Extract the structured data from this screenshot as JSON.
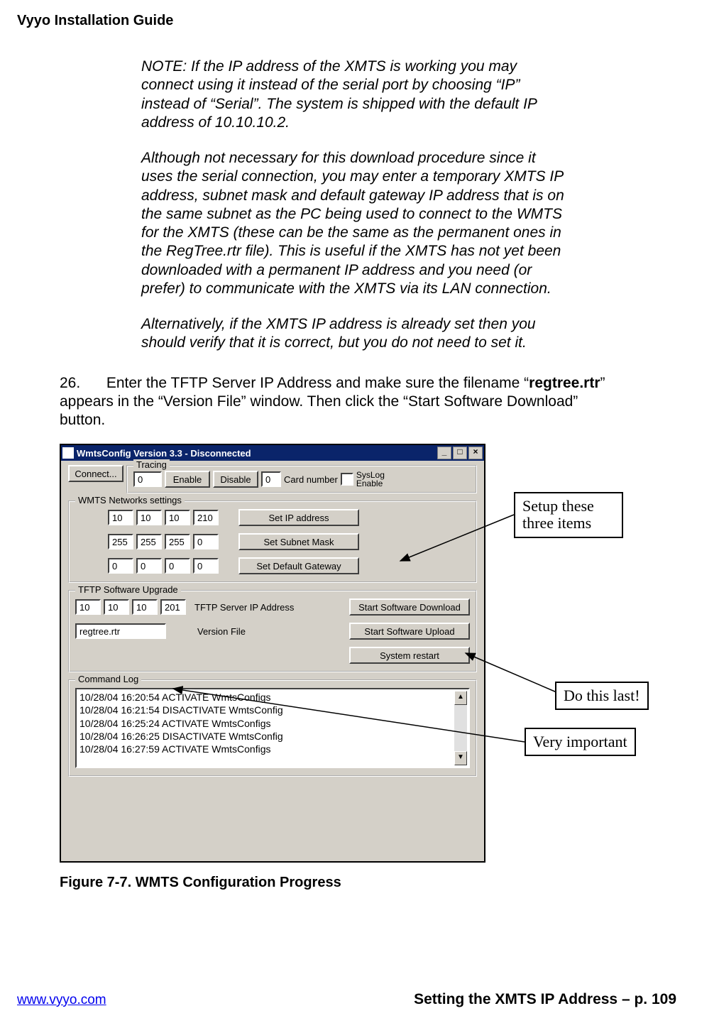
{
  "header": "Vyyo Installation Guide",
  "notes": {
    "p1": "NOTE:  If the IP address of the XMTS is working you may connect using it instead of the serial port by choosing “IP” instead of “Serial”.  The system is shipped with the default IP address of 10.10.10.2.",
    "p2": "Although not necessary for this download procedure since it uses the serial connection, you may enter a temporary XMTS  IP address, subnet mask and default gateway IP address that is on the same subnet as the PC being used to connect to the WMTS for the XMTS (these can be the same as the permanent ones in the RegTree.rtr file).   This is useful if the XMTS has not yet been downloaded with a permanent IP address and you need  (or prefer) to communicate with the XMTS via its LAN connection.",
    "p3": "Alternatively, if the XMTS IP address is already set then you should verify that it is correct, but you do not need to set it."
  },
  "step": {
    "number": "26.",
    "before_bold": "Enter the TFTP Server IP Address and make sure the filename “",
    "bold": "regtree.rtr",
    "after_bold": "” appears in the “Version File” window. Then click the “Start Software Download” button."
  },
  "figure_caption": "Figure 7-7. WMTS Configuration Progress",
  "callouts": {
    "setup": "Setup these\nthree items",
    "last": "Do this last!",
    "important": "Very important"
  },
  "app": {
    "title": "WmtsConfig Version 3.3 - Disconnected",
    "connect": "Connect...",
    "tracing": {
      "group": "Tracing",
      "value": "0",
      "enable": "Enable",
      "disable": "Disable",
      "card_value": "0",
      "card_label": "Card number",
      "syslog": "SysLog\nEnable"
    },
    "networks": {
      "group": "WMTS Networks settings",
      "ip": [
        "10",
        "10",
        "10",
        "210"
      ],
      "subnet": [
        "255",
        "255",
        "255",
        "0"
      ],
      "gateway": [
        "0",
        "0",
        "0",
        "0"
      ],
      "set_ip": "Set IP address",
      "set_subnet": "Set Subnet Mask",
      "set_gateway": "Set Default Gateway"
    },
    "tftp": {
      "group": "TFTP Software Upgrade",
      "server": [
        "10",
        "10",
        "10",
        "201"
      ],
      "server_label": "TFTP Server IP Address",
      "version_file": "regtree.rtr",
      "version_label": "Version File",
      "start_download": "Start Software Download",
      "start_upload": "Start Software Upload",
      "restart": "System restart"
    },
    "log": {
      "group": "Command Log",
      "entries": [
        "10/28/04 16:20:54 ACTIVATE WmtsConfigs",
        "10/28/04 16:21:54 DISACTIVATE WmtsConfig",
        "10/28/04 16:25:24 ACTIVATE WmtsConfigs",
        "10/28/04 16:26:25 DISACTIVATE WmtsConfig",
        "10/28/04 16:27:59 ACTIVATE WmtsConfigs"
      ]
    }
  },
  "footer": {
    "url": "www.vyyo.com",
    "right": "Setting the XMTS IP Address – p. 109"
  }
}
